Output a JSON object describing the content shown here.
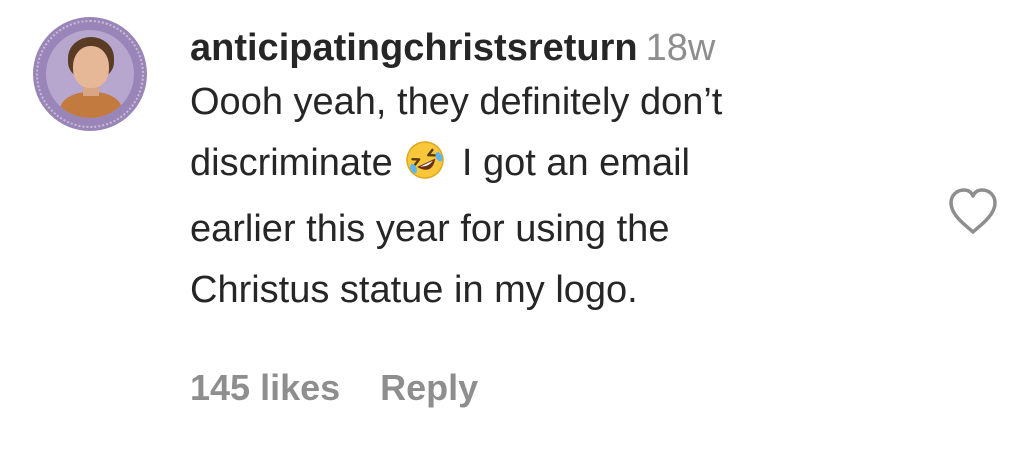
{
  "comment": {
    "username": "anticipatingchristsreturn",
    "timestamp": "18w",
    "text_lines": [
      "Oooh yeah, they definitely don’t",
      "discriminate",
      "I got an email",
      "earlier this year for using the",
      "Christus statue in my logo."
    ],
    "emoji_icon": "rolling-on-floor-laughing-emoji",
    "likes": "145 likes",
    "reply_label": "Reply",
    "like_icon": "heart-outline-icon"
  }
}
